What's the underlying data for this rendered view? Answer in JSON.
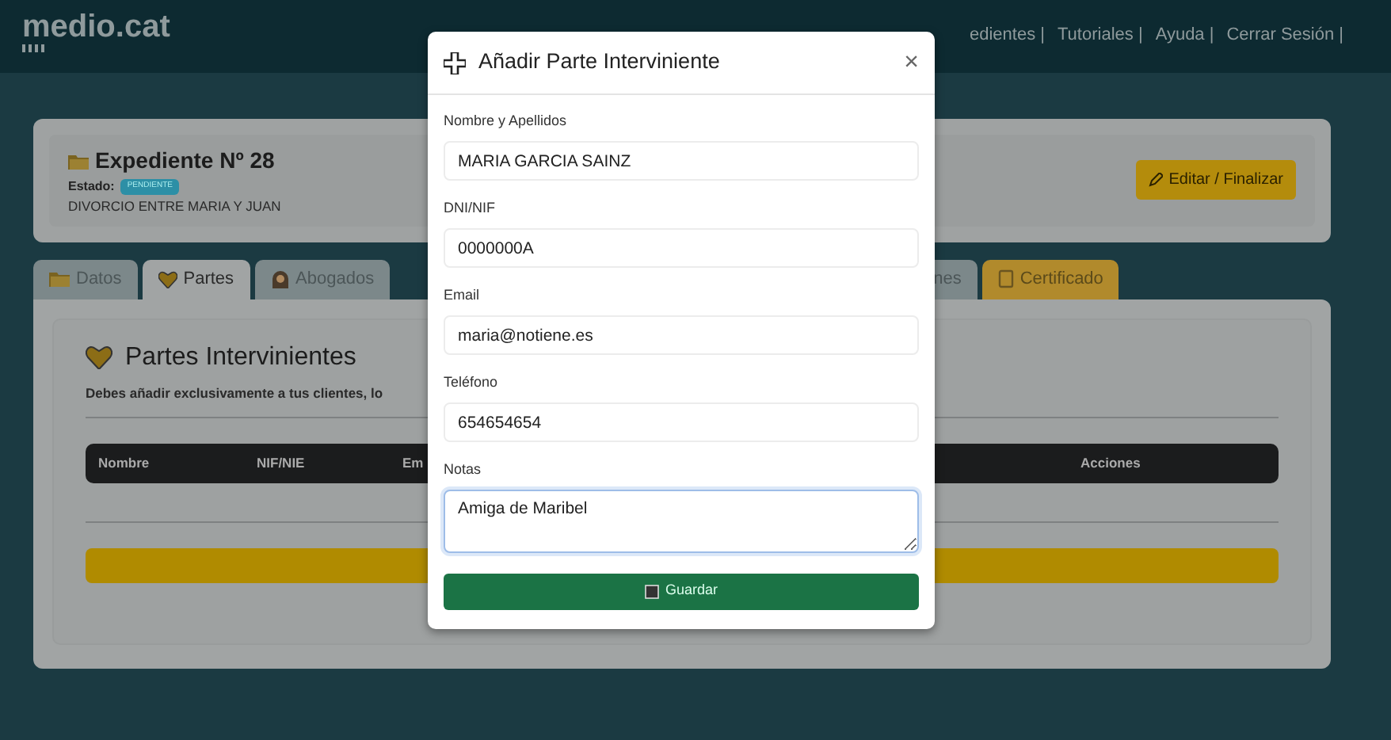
{
  "navbar": {
    "brand": "medio.cat",
    "links": [
      "edientes |",
      "Tutoriales |",
      "Ayuda |",
      "Cerrar Sesión |"
    ]
  },
  "header": {
    "title": "Expediente Nº 28",
    "estado_label": "Estado:",
    "estado_badge": "PENDIENTE",
    "description": "DIVORCIO ENTRE MARIA Y JUAN",
    "edit_button": "Editar / Finalizar"
  },
  "tabs": [
    {
      "label": "Datos",
      "selected": false,
      "kind": "folder"
    },
    {
      "label": "Partes",
      "selected": true,
      "kind": "heart"
    },
    {
      "label": "Abogados",
      "selected": false,
      "kind": "person"
    },
    {
      "label": "nes",
      "selected": false,
      "kind": "cut"
    },
    {
      "label": "Certificado",
      "selected": false,
      "kind": "document"
    }
  ],
  "section": {
    "title": "Partes Intervinientes",
    "intro": "Debes añadir exclusivamente a tus clientes, lo",
    "columns": [
      "Nombre",
      "NIF/NIE",
      "Em",
      "Acciones"
    ]
  },
  "modal": {
    "title": "Añadir Parte Interviniente",
    "close": "×",
    "fields": [
      {
        "label": "Nombre y Apellidos",
        "value": "MARIA GARCIA SAINZ",
        "kind": "input",
        "focused": false
      },
      {
        "label": "DNI/NIF",
        "value": "0000000A",
        "kind": "input",
        "focused": false
      },
      {
        "label": "Email",
        "value": "maria@notiene.es",
        "kind": "input",
        "focused": false
      },
      {
        "label": "Teléfono",
        "value": "654654654",
        "kind": "input",
        "focused": false
      },
      {
        "label": "Notas",
        "value": "Amiga de Maribel",
        "kind": "textarea",
        "focused": true
      }
    ],
    "submit": "Guardar"
  }
}
